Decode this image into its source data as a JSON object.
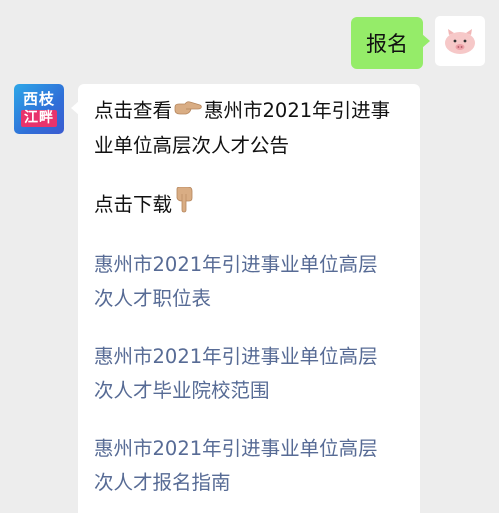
{
  "outgoing": {
    "text": "报名"
  },
  "incoming": {
    "avatar": {
      "line1": "西枝",
      "line2": "江畔"
    },
    "intro": {
      "prefix": "点击查看",
      "pointer_emoji": "backhand-index-pointing-right",
      "title": "惠州市2021年引进事业单位高层次人才公告"
    },
    "download": {
      "label": "点击下载",
      "pointer_emoji": "backhand-index-pointing-down"
    },
    "links": [
      {
        "line1": "惠州市2021年引进事业单位高层",
        "line2": "次人才职位表"
      },
      {
        "line1": "惠州市2021年引进事业单位高层",
        "line2": "次人才毕业院校范围"
      },
      {
        "line1": "惠州市2021年引进事业单位高层",
        "line2": "次人才报名指南"
      }
    ]
  },
  "colors": {
    "background": "#ededed",
    "outgoing_bubble": "#95ec69",
    "link_text": "#576b95",
    "brand_blue": "#2f6fd8",
    "brand_pink": "#e8336c"
  }
}
